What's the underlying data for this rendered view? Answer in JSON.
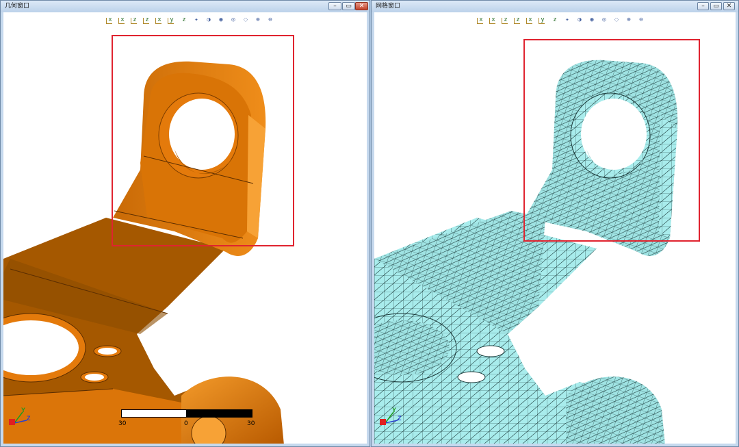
{
  "geometry_window": {
    "title": "几何窗口",
    "toolbar": [
      "x",
      "x",
      "z",
      "z",
      "x",
      "y",
      "z",
      "✦",
      "◑",
      "◉",
      "◎",
      "◌",
      "⊕",
      "⊖"
    ],
    "scale_bar": {
      "left_label": "30",
      "mid_label": "0",
      "right_label": "30"
    },
    "triad": {
      "y": "Y",
      "z": "Z"
    }
  },
  "mesh_window": {
    "title": "网格窗口",
    "toolbar": [
      "x",
      "x",
      "z",
      "z",
      "x",
      "y",
      "z",
      "✦",
      "◑",
      "◉",
      "◎",
      "◌",
      "⊕",
      "⊖"
    ],
    "triad": {
      "y": "Y",
      "z": "Z"
    }
  },
  "window_controls": {
    "minimize": "–",
    "maximize": "▭",
    "close": "✕"
  },
  "colors": {
    "part_orange": "#e47a0b",
    "mesh_cyan": "#a8ecec",
    "selection": "#e0232f"
  }
}
